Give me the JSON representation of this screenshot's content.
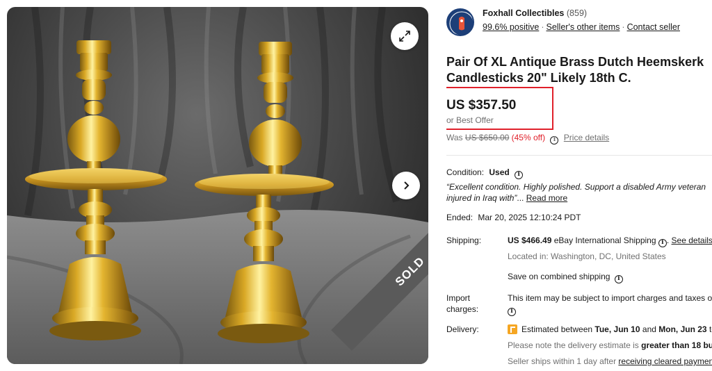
{
  "gallery": {
    "sold_label": "SOLD"
  },
  "seller": {
    "name": "Foxhall Collectibles",
    "feedback_count": "(859)",
    "positive": "99.6% positive",
    "other_items": "Seller's other items",
    "contact": "Contact seller"
  },
  "listing": {
    "title_line1": "Pair Of XL Antique Brass Dutch Heemskerk",
    "title_line2": "Candlesticks 20\" Likely 18th C.",
    "price": "US $357.50",
    "best_offer": "or Best Offer",
    "was_label": "Was",
    "was_price": "US $650.00",
    "discount": "(45% off)",
    "price_details": "Price details"
  },
  "condition": {
    "label": "Condition:",
    "value": "Used",
    "quote_line1": "“Excellent condition. Highly polished. Support a disabled Army veteran",
    "quote_line2": "injured in Iraq with”",
    "ellipsis": "...",
    "read_more": "Read more"
  },
  "ended": {
    "label": "Ended:",
    "value": "Mar 20, 2025 12:10:24 PDT"
  },
  "shipping": {
    "label": "Shipping:",
    "cost": "US $466.49",
    "method": "eBay International Shipping",
    "see_details": "See details",
    "location": "Located in: Washington, DC, United States",
    "combined": "Save on combined shipping"
  },
  "import": {
    "label_line1": "Import",
    "label_line2": "charges:",
    "text": "This item may be subject to import charges and taxes o"
  },
  "delivery": {
    "label": "Delivery:",
    "estimated_prefix": "Estimated between",
    "date_start": "Tue, Jun 10",
    "and_word": "and",
    "date_end": "Mon, Jun 23",
    "to_word": "to",
    "note_prefix": "Please note the delivery estimate is",
    "note_bold": "greater than 18 bu",
    "ships_prefix": "Seller ships within 1 day after",
    "ships_link": "receiving cleared payment"
  },
  "colors": {
    "highlight_border": "#e0202a",
    "discount": "#e0202a",
    "delivery_flag": "#f5a623",
    "seller_badge": "#1d3f78"
  },
  "icons": [
    "expand-icon",
    "chevron-right-icon",
    "info-icon",
    "delivery-flag-icon",
    "seller-logo"
  ]
}
